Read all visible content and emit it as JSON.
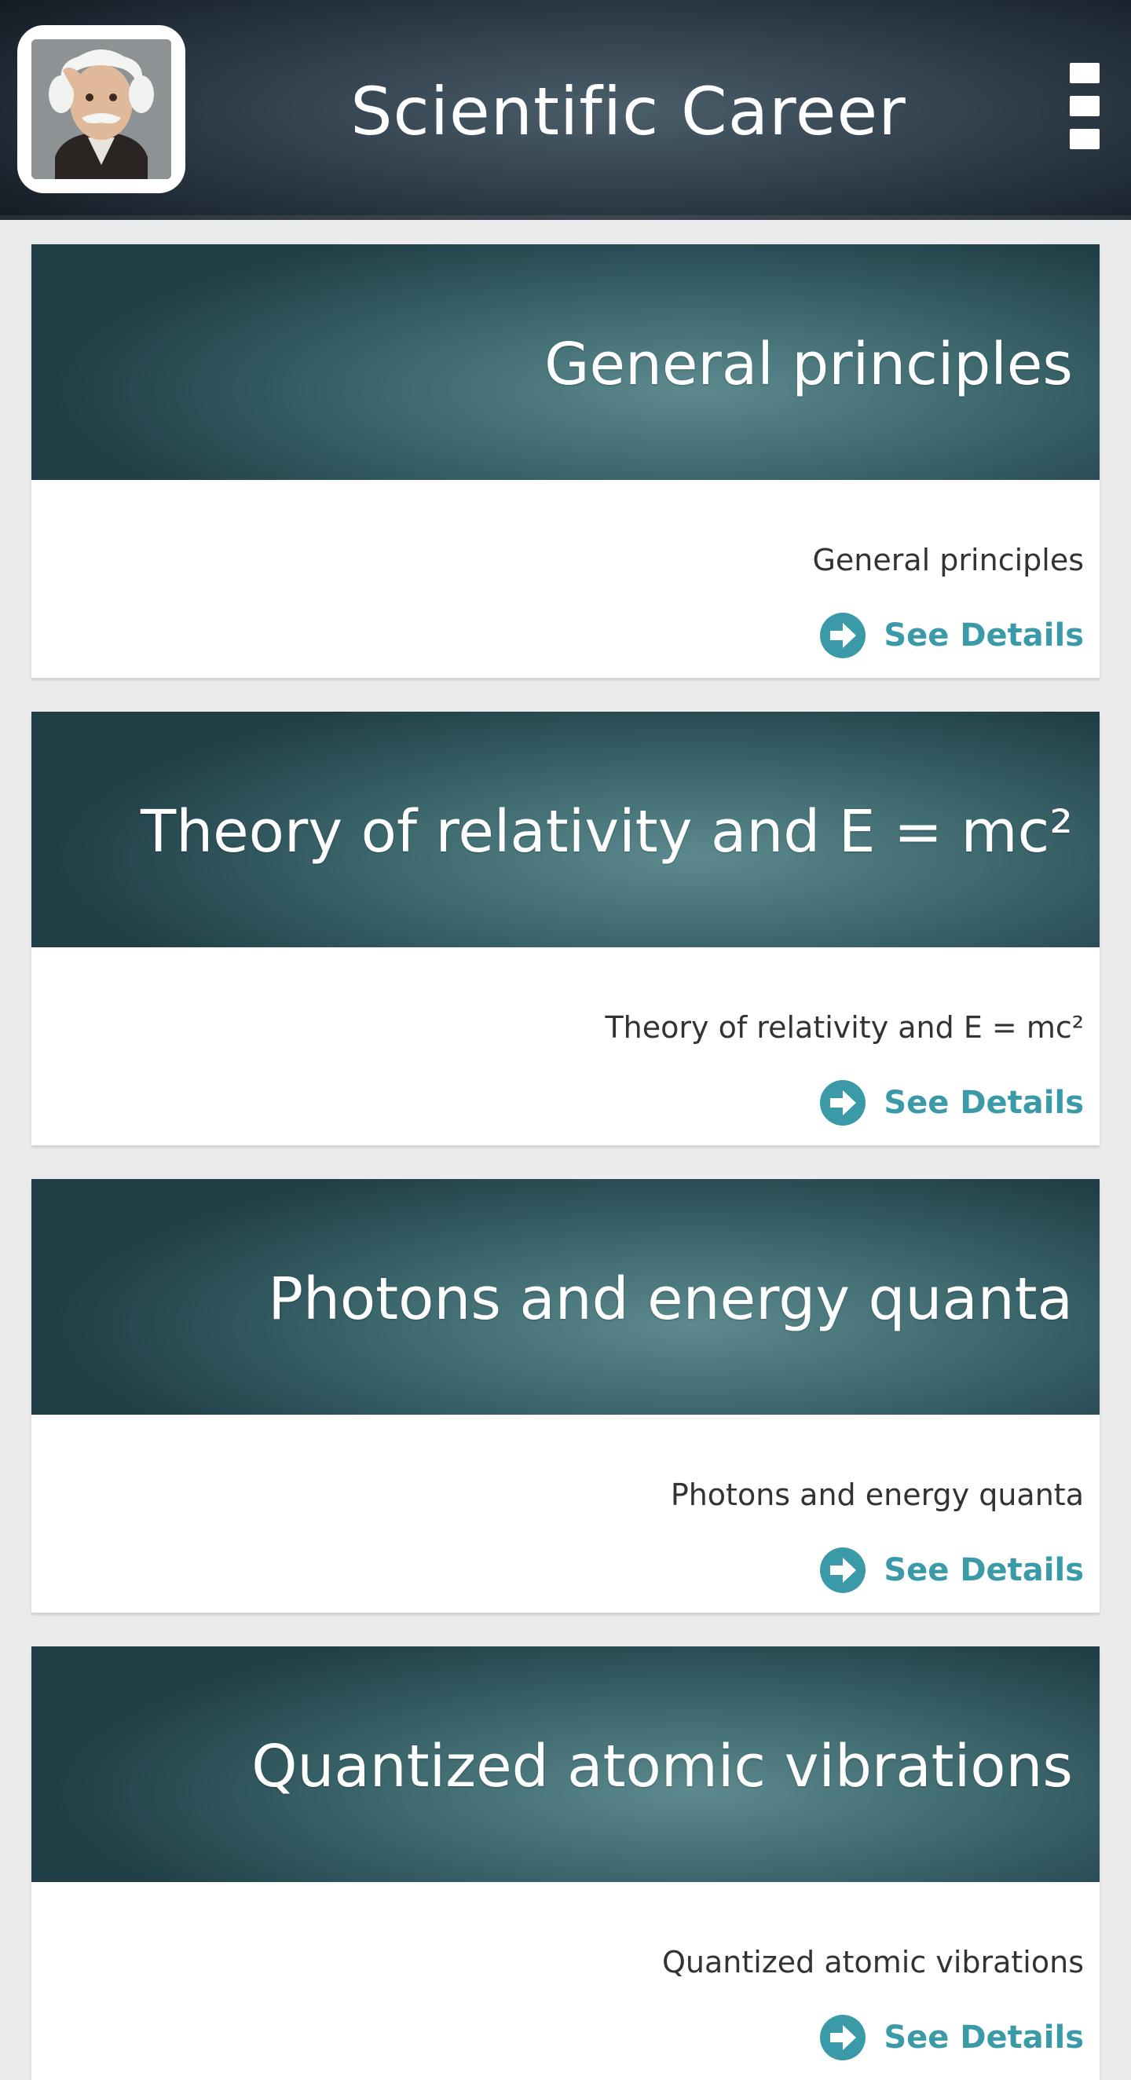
{
  "app_bar": {
    "title": "Scientific Career"
  },
  "cards": [
    {
      "banner_title": "General principles",
      "subtitle": "General principles",
      "link_label": "See Details"
    },
    {
      "banner_title": "Theory of relativity and E = mc²",
      "subtitle": "Theory of relativity and E = mc²",
      "link_label": "See Details"
    },
    {
      "banner_title": "Photons and energy quanta",
      "subtitle": "Photons and energy quanta",
      "link_label": "See Details"
    },
    {
      "banner_title": "Quantized atomic vibrations",
      "subtitle": "Quantized atomic vibrations",
      "link_label": "See Details"
    }
  ],
  "colors": {
    "link": "#3b9aa8",
    "banner": "#3e6a70",
    "app_bar": "#2c3a46"
  },
  "icons": {
    "avatar": "einstein-portrait",
    "menu": "overflow-menu-icon",
    "link": "arrow-circle-right-icon"
  }
}
